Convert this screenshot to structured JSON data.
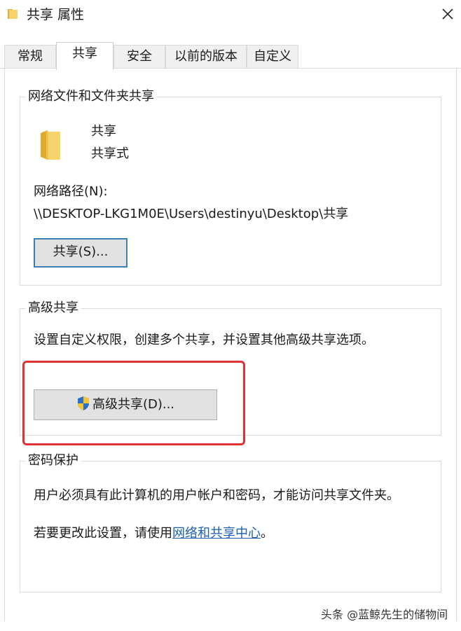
{
  "window": {
    "title": "共享 属性",
    "close_icon": "close-icon"
  },
  "tabs": [
    {
      "label": "常规",
      "active": false
    },
    {
      "label": "共享",
      "active": true
    },
    {
      "label": "安全",
      "active": false
    },
    {
      "label": "以前的版本",
      "active": false
    },
    {
      "label": "自定义",
      "active": false
    }
  ],
  "network_sharing": {
    "group_title": "网络文件和文件夹共享",
    "folder_name": "共享",
    "share_state": "共享式",
    "path_label": "网络路径(N):",
    "path_value": "\\\\DESKTOP-LKG1M0E\\Users\\destinyu\\Desktop\\共享",
    "share_button": "共享(S)..."
  },
  "advanced_sharing": {
    "group_title": "高级共享",
    "description": "设置自定义权限，创建多个共享，并设置其他高级共享选项。",
    "button_label": "高级共享(D)...",
    "highlight_color": "#e03232"
  },
  "password_protection": {
    "group_title": "密码保护",
    "description": "用户必须具有此计算机的用户帐户和密码，才能访问共享文件夹。",
    "change_prefix": "若要更改此设置，请使用",
    "link_text": "网络和共享中心",
    "change_suffix": "。"
  },
  "watermark": "头条 @蓝鲸先生的储物间",
  "colors": {
    "folder": "#f2c94c",
    "link": "#1a5fb4",
    "default_button_border": "#3c7fb1"
  }
}
